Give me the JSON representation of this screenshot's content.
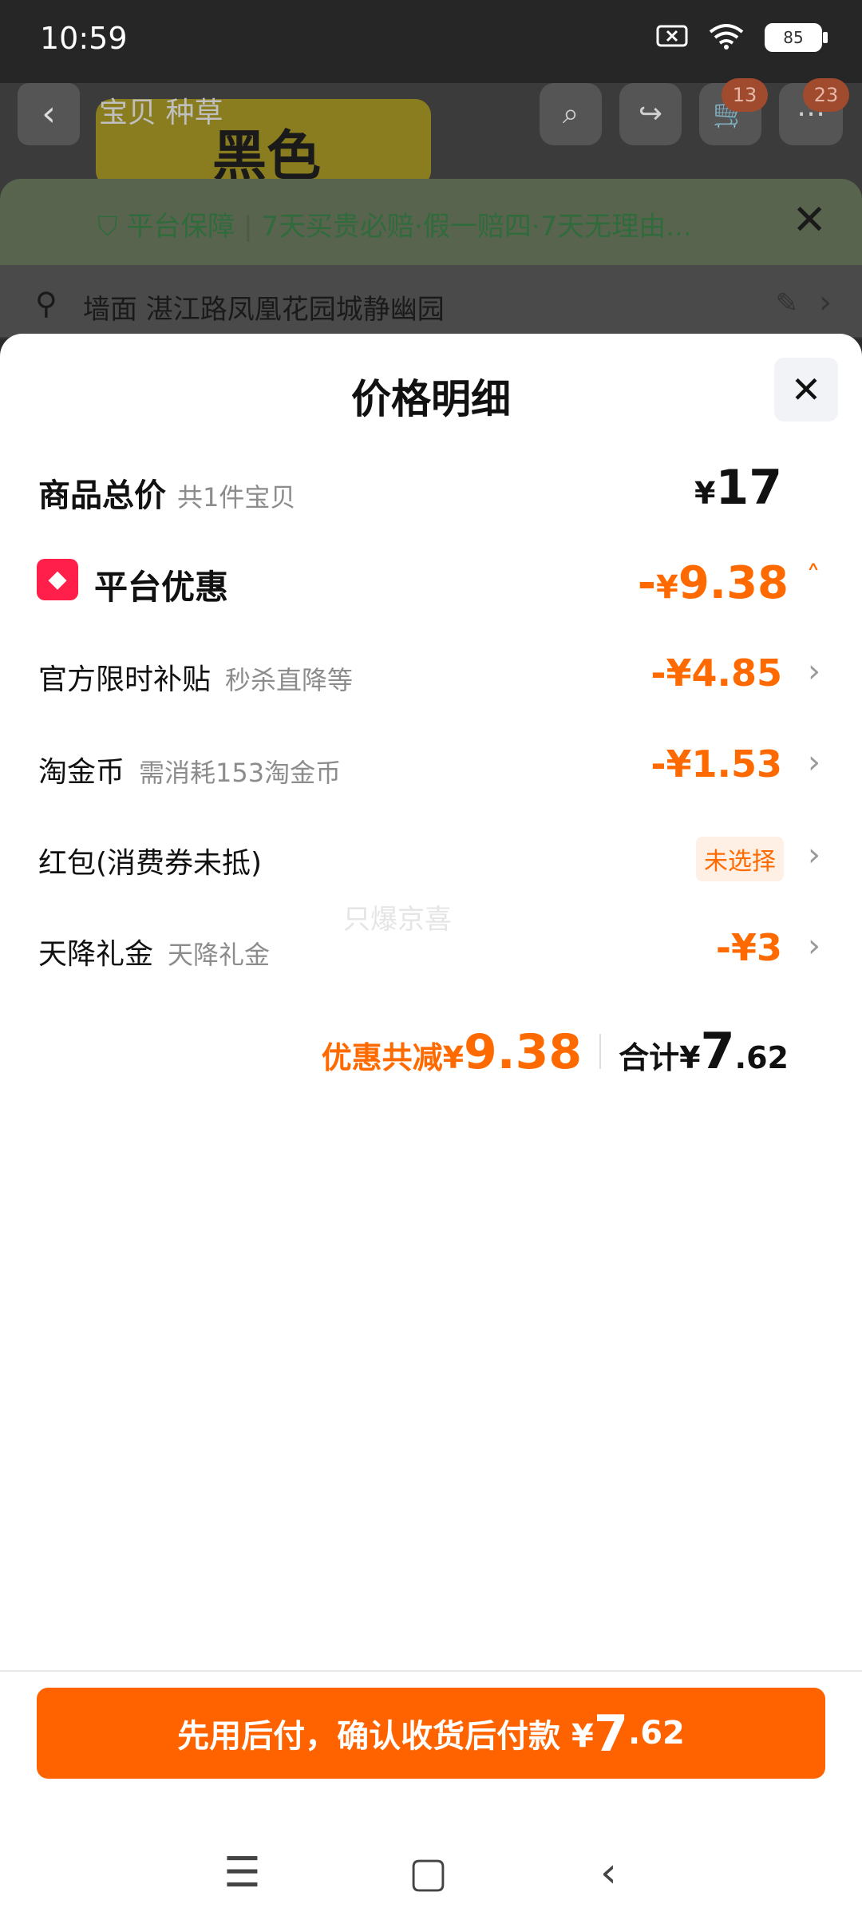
{
  "status_bar": {
    "time": "10:59",
    "battery": "85"
  },
  "background": {
    "tabs": "宝贝  种草",
    "banner_text": "黑色",
    "cart_badge": "13",
    "msg_badge": "23",
    "guarantee_title": "平台保障",
    "guarantee_text": "7天买贵必赔·假一赔四·7天无理由...",
    "address": "墙面 湛江路凤凰花园城静幽园"
  },
  "sheet": {
    "title": "价格明细",
    "total": {
      "label": "商品总价",
      "sub": "共1件宝贝",
      "currency": "¥",
      "amount": "17"
    },
    "promo": {
      "label": "平台优惠",
      "prefix": "-",
      "currency": "¥",
      "amount": "9.38"
    },
    "rows": [
      {
        "label": "官方限时补贴",
        "sub": "秒杀直降等",
        "value": "-¥4.85"
      },
      {
        "label": "淘金币",
        "sub": "需消耗153淘金币",
        "value": "-¥1.53"
      },
      {
        "label": "红包(消费券未抵)",
        "sub": "",
        "value": "未选择"
      },
      {
        "label": "天降礼金",
        "sub": "天降礼金",
        "value": "-¥3"
      }
    ],
    "watermark": "只爆京喜",
    "summary": {
      "discount_label": "优惠共减¥",
      "discount_amount": "9.38",
      "total_label": "合计¥",
      "total_int": "7",
      "total_dec": ".62"
    },
    "pay_button": {
      "label": "先用后付，确认收货后付款 ¥",
      "amount_int": "7",
      "amount_dec": ".62"
    }
  },
  "colors": {
    "accent": "#ff6a00",
    "button": "#ff6300",
    "promo_icon": "#ff1f4a"
  }
}
